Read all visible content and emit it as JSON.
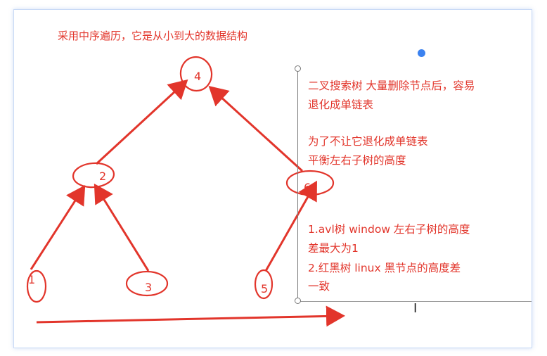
{
  "title": "采用中序遍历，它是从小到大的数据结构",
  "tree": {
    "nodes": [
      "4",
      "2",
      "6",
      "1",
      "3",
      "5"
    ]
  },
  "textbox": {
    "lines": [
      "二叉搜索树 大量删除节点后，容易",
      "退化成单链表",
      "",
      "为了不让它退化成单链表",
      "平衡左右子树的高度",
      "",
      "",
      "1.avl树  window 左右子树的高度",
      "差最大为1",
      "2.红黑树 linux 黑节点的高度差",
      "一致"
    ]
  },
  "colors": {
    "ink": "#e2352b",
    "selection_handle": "#3b82f0"
  },
  "cursor_icon": "text-cursor-icon"
}
